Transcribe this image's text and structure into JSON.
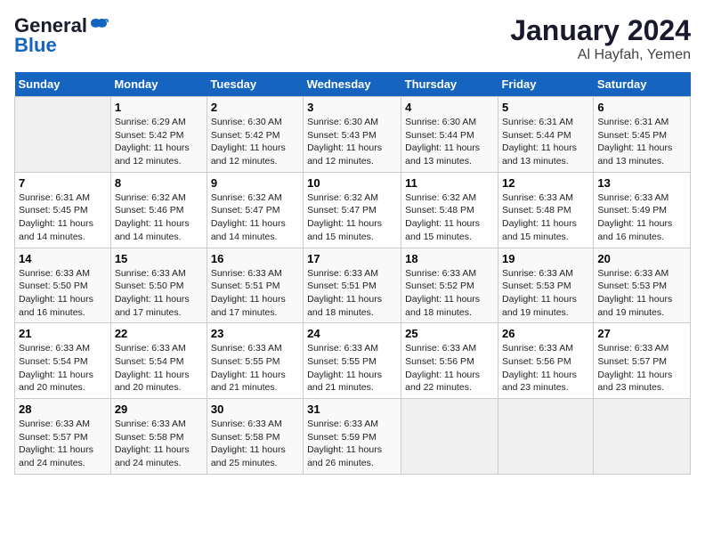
{
  "header": {
    "logo_line1": "General",
    "logo_line2": "Blue",
    "main_title": "January 2024",
    "sub_title": "Al Hayfah, Yemen"
  },
  "days_of_week": [
    "Sunday",
    "Monday",
    "Tuesday",
    "Wednesday",
    "Thursday",
    "Friday",
    "Saturday"
  ],
  "weeks": [
    [
      {
        "day": "",
        "info": ""
      },
      {
        "day": "1",
        "info": "Sunrise: 6:29 AM\nSunset: 5:42 PM\nDaylight: 11 hours\nand 12 minutes."
      },
      {
        "day": "2",
        "info": "Sunrise: 6:30 AM\nSunset: 5:42 PM\nDaylight: 11 hours\nand 12 minutes."
      },
      {
        "day": "3",
        "info": "Sunrise: 6:30 AM\nSunset: 5:43 PM\nDaylight: 11 hours\nand 12 minutes."
      },
      {
        "day": "4",
        "info": "Sunrise: 6:30 AM\nSunset: 5:44 PM\nDaylight: 11 hours\nand 13 minutes."
      },
      {
        "day": "5",
        "info": "Sunrise: 6:31 AM\nSunset: 5:44 PM\nDaylight: 11 hours\nand 13 minutes."
      },
      {
        "day": "6",
        "info": "Sunrise: 6:31 AM\nSunset: 5:45 PM\nDaylight: 11 hours\nand 13 minutes."
      }
    ],
    [
      {
        "day": "7",
        "info": "Sunrise: 6:31 AM\nSunset: 5:45 PM\nDaylight: 11 hours\nand 14 minutes."
      },
      {
        "day": "8",
        "info": "Sunrise: 6:32 AM\nSunset: 5:46 PM\nDaylight: 11 hours\nand 14 minutes."
      },
      {
        "day": "9",
        "info": "Sunrise: 6:32 AM\nSunset: 5:47 PM\nDaylight: 11 hours\nand 14 minutes."
      },
      {
        "day": "10",
        "info": "Sunrise: 6:32 AM\nSunset: 5:47 PM\nDaylight: 11 hours\nand 15 minutes."
      },
      {
        "day": "11",
        "info": "Sunrise: 6:32 AM\nSunset: 5:48 PM\nDaylight: 11 hours\nand 15 minutes."
      },
      {
        "day": "12",
        "info": "Sunrise: 6:33 AM\nSunset: 5:48 PM\nDaylight: 11 hours\nand 15 minutes."
      },
      {
        "day": "13",
        "info": "Sunrise: 6:33 AM\nSunset: 5:49 PM\nDaylight: 11 hours\nand 16 minutes."
      }
    ],
    [
      {
        "day": "14",
        "info": "Sunrise: 6:33 AM\nSunset: 5:50 PM\nDaylight: 11 hours\nand 16 minutes."
      },
      {
        "day": "15",
        "info": "Sunrise: 6:33 AM\nSunset: 5:50 PM\nDaylight: 11 hours\nand 17 minutes."
      },
      {
        "day": "16",
        "info": "Sunrise: 6:33 AM\nSunset: 5:51 PM\nDaylight: 11 hours\nand 17 minutes."
      },
      {
        "day": "17",
        "info": "Sunrise: 6:33 AM\nSunset: 5:51 PM\nDaylight: 11 hours\nand 18 minutes."
      },
      {
        "day": "18",
        "info": "Sunrise: 6:33 AM\nSunset: 5:52 PM\nDaylight: 11 hours\nand 18 minutes."
      },
      {
        "day": "19",
        "info": "Sunrise: 6:33 AM\nSunset: 5:53 PM\nDaylight: 11 hours\nand 19 minutes."
      },
      {
        "day": "20",
        "info": "Sunrise: 6:33 AM\nSunset: 5:53 PM\nDaylight: 11 hours\nand 19 minutes."
      }
    ],
    [
      {
        "day": "21",
        "info": "Sunrise: 6:33 AM\nSunset: 5:54 PM\nDaylight: 11 hours\nand 20 minutes."
      },
      {
        "day": "22",
        "info": "Sunrise: 6:33 AM\nSunset: 5:54 PM\nDaylight: 11 hours\nand 20 minutes."
      },
      {
        "day": "23",
        "info": "Sunrise: 6:33 AM\nSunset: 5:55 PM\nDaylight: 11 hours\nand 21 minutes."
      },
      {
        "day": "24",
        "info": "Sunrise: 6:33 AM\nSunset: 5:55 PM\nDaylight: 11 hours\nand 21 minutes."
      },
      {
        "day": "25",
        "info": "Sunrise: 6:33 AM\nSunset: 5:56 PM\nDaylight: 11 hours\nand 22 minutes."
      },
      {
        "day": "26",
        "info": "Sunrise: 6:33 AM\nSunset: 5:56 PM\nDaylight: 11 hours\nand 23 minutes."
      },
      {
        "day": "27",
        "info": "Sunrise: 6:33 AM\nSunset: 5:57 PM\nDaylight: 11 hours\nand 23 minutes."
      }
    ],
    [
      {
        "day": "28",
        "info": "Sunrise: 6:33 AM\nSunset: 5:57 PM\nDaylight: 11 hours\nand 24 minutes."
      },
      {
        "day": "29",
        "info": "Sunrise: 6:33 AM\nSunset: 5:58 PM\nDaylight: 11 hours\nand 24 minutes."
      },
      {
        "day": "30",
        "info": "Sunrise: 6:33 AM\nSunset: 5:58 PM\nDaylight: 11 hours\nand 25 minutes."
      },
      {
        "day": "31",
        "info": "Sunrise: 6:33 AM\nSunset: 5:59 PM\nDaylight: 11 hours\nand 26 minutes."
      },
      {
        "day": "",
        "info": ""
      },
      {
        "day": "",
        "info": ""
      },
      {
        "day": "",
        "info": ""
      }
    ]
  ]
}
